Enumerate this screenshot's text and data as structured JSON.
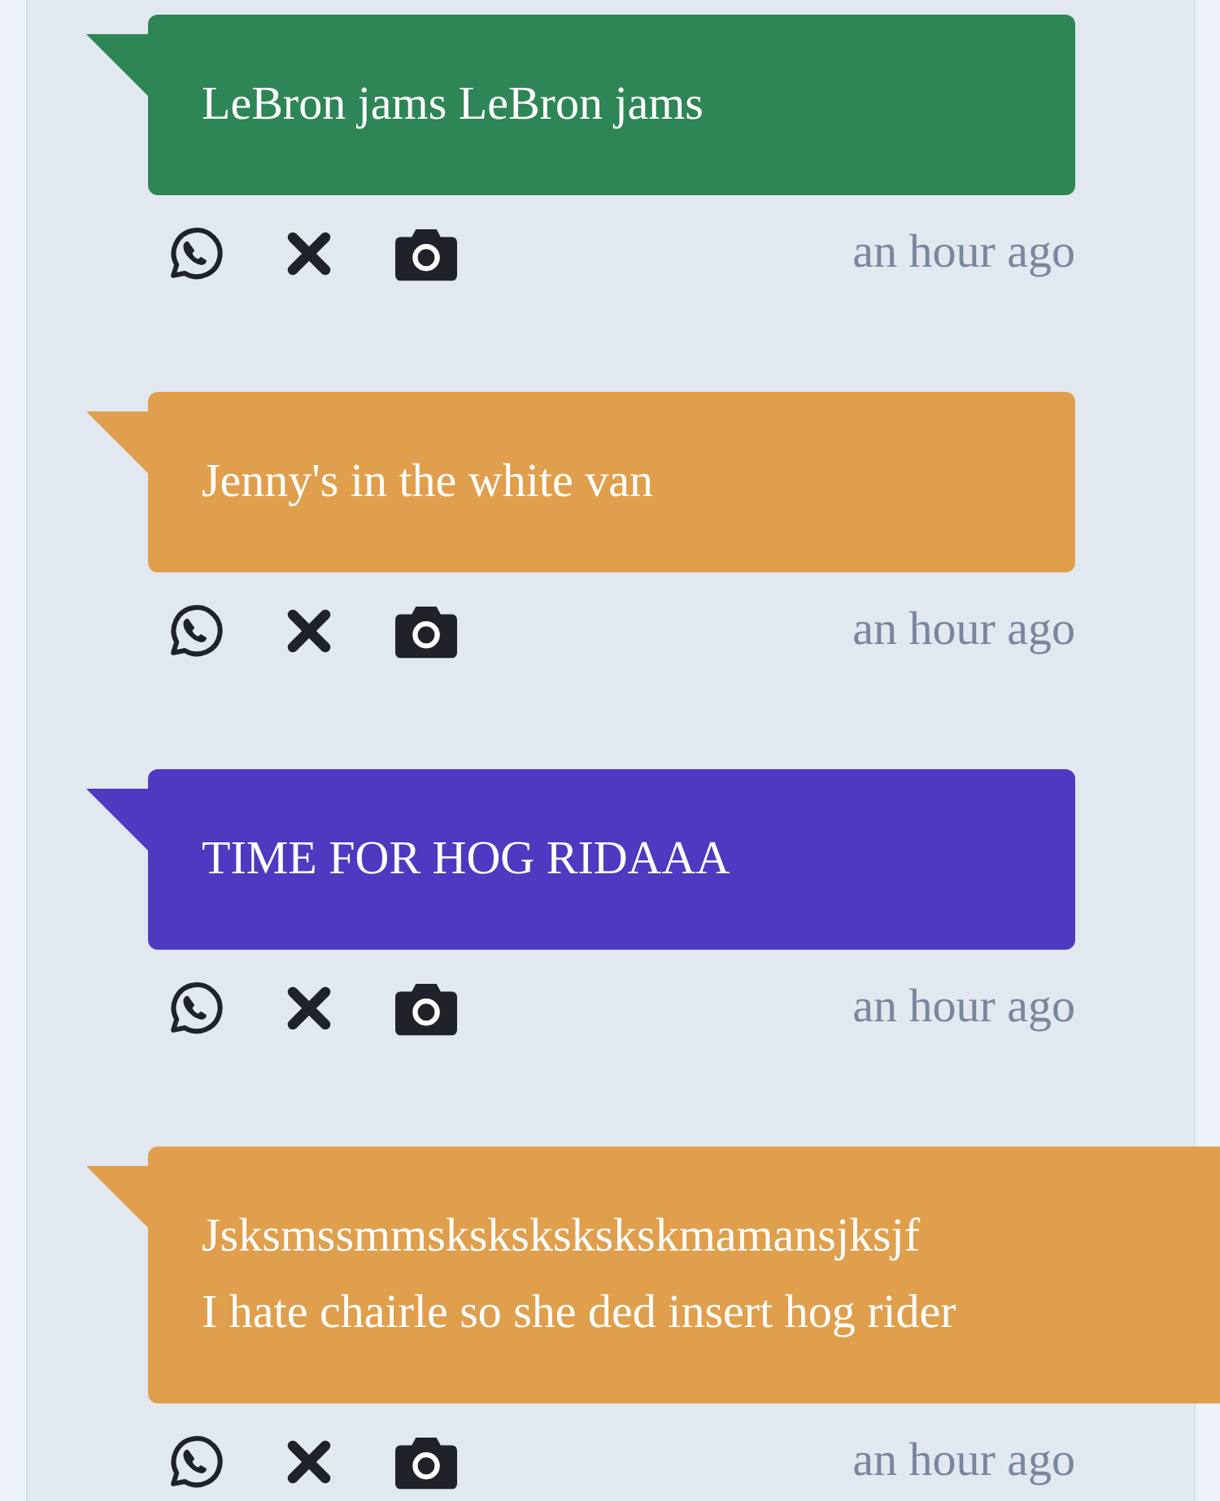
{
  "messages": [
    {
      "lines": [
        "LeBron jams LeBron jams"
      ],
      "color": "#2e8555",
      "time": "an hour ago",
      "cut_off": false
    },
    {
      "lines": [
        "Jenny's in the white van"
      ],
      "color": "#e09f4c",
      "time": "an hour ago",
      "cut_off": false
    },
    {
      "lines": [
        "TIME FOR HOG RIDAAA"
      ],
      "color": "#4f39c0",
      "time": "an hour ago",
      "cut_off": false
    },
    {
      "lines": [
        "Jsksmssmmskskskskskskmamansjksjf",
        "I hate chairle so she ded insert hog rider"
      ],
      "color": "#e09f4c",
      "time": "an hour ago",
      "cut_off": true
    }
  ]
}
